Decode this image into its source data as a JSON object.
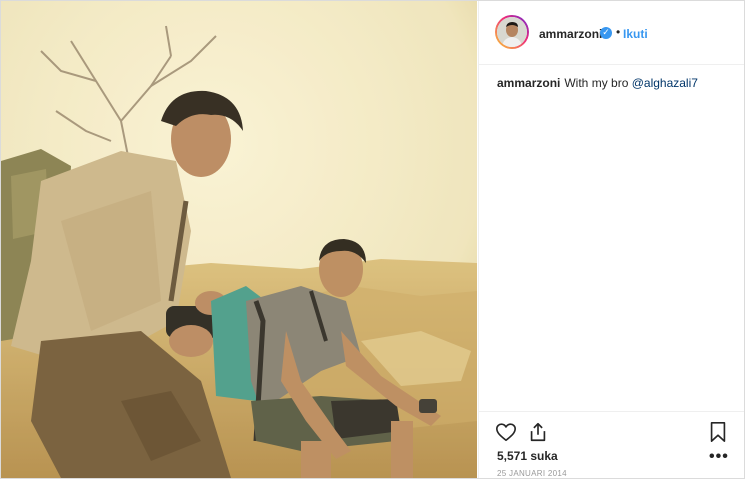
{
  "post": {
    "username": "ammarzoni",
    "verified": true,
    "separator": "•",
    "follow_label": "Ikuti",
    "caption_user": "ammarzoni",
    "caption_text": "With my bro",
    "caption_mention": "@alghazali7",
    "likes": "5,571 suka",
    "date": "25 JANUARI 2014",
    "more_label": "•••"
  },
  "colors": {
    "accent": "#3897f0",
    "text": "#262626",
    "muted": "#999999",
    "border": "#dbdbdb"
  },
  "icons": {
    "verified": "verified-badge-icon",
    "like": "heart-icon",
    "share": "share-icon",
    "save": "bookmark-icon",
    "more": "more-options-icon"
  }
}
